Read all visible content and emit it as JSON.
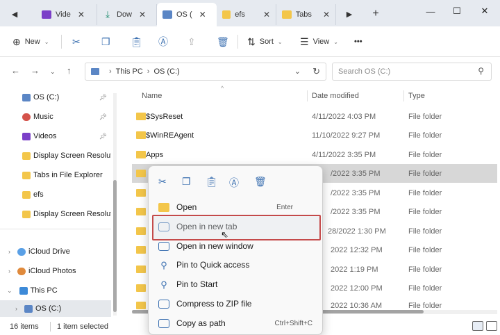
{
  "tabs": [
    {
      "label": "Vide",
      "icon": "video-icon"
    },
    {
      "label": "Dow",
      "icon": "download-icon"
    },
    {
      "label": "OS (",
      "icon": "drive-icon"
    },
    {
      "label": "efs",
      "icon": "folder-icon"
    },
    {
      "label": "Tabs",
      "icon": "folder-icon"
    }
  ],
  "toolbar": {
    "new_label": "New",
    "sort_label": "Sort",
    "view_label": "View",
    "more_label": "•••"
  },
  "address": {
    "segments": [
      "This PC",
      "OS (C:)"
    ]
  },
  "search": {
    "placeholder": "Search OS (C:)"
  },
  "sidebar": {
    "items": [
      {
        "label": "OS (C:)",
        "pinned": true
      },
      {
        "label": "Music",
        "pinned": true
      },
      {
        "label": "Videos",
        "pinned": true
      },
      {
        "label": "Display Screen Resolutio"
      },
      {
        "label": "Tabs in File Explorer"
      },
      {
        "label": "efs"
      },
      {
        "label": "Display Screen Resolutio"
      },
      {
        "label": "iCloud Drive"
      },
      {
        "label": "iCloud Photos"
      },
      {
        "label": "This PC"
      },
      {
        "label": "OS (C:)"
      }
    ]
  },
  "columns": {
    "name": "Name",
    "date": "Date modified",
    "type": "Type"
  },
  "files": [
    {
      "name": "$SysReset",
      "date": "4/11/2022 4:03 PM",
      "type": "File folder"
    },
    {
      "name": "$WinREAgent",
      "date": "11/10/2022 9:27 PM",
      "type": "File folder"
    },
    {
      "name": "Apps",
      "date": "4/11/2022 3:35 PM",
      "type": "File folder"
    },
    {
      "name": "",
      "date": "/2022 3:35 PM",
      "type": "File folder"
    },
    {
      "name": "",
      "date": "/2022 3:35 PM",
      "type": "File folder"
    },
    {
      "name": "",
      "date": "/2022 3:35 PM",
      "type": "File folder"
    },
    {
      "name": "",
      "date": "28/2022 1:30 PM",
      "type": "File folder"
    },
    {
      "name": "",
      "date": "2022 12:32 PM",
      "type": "File folder"
    },
    {
      "name": "",
      "date": "2022 1:19 PM",
      "type": "File folder"
    },
    {
      "name": "",
      "date": "2022 12:00 PM",
      "type": "File folder"
    },
    {
      "name": "",
      "date": "2022 10:36 AM",
      "type": "File folder"
    }
  ],
  "status": {
    "count": "16 items",
    "selected": "1 item selected"
  },
  "context_menu": {
    "items": [
      {
        "label": "Open",
        "shortcut": "Enter"
      },
      {
        "label": "Open in new tab",
        "shortcut": ""
      },
      {
        "label": "Open in new window",
        "shortcut": ""
      },
      {
        "label": "Pin to Quick access",
        "shortcut": ""
      },
      {
        "label": "Pin to Start",
        "shortcut": ""
      },
      {
        "label": "Compress to ZIP file",
        "shortcut": ""
      },
      {
        "label": "Copy as path",
        "shortcut": "Ctrl+Shift+C"
      }
    ]
  },
  "colors": {
    "accent": "#3a6fb0",
    "folder": "#f3c64a",
    "highlight_border": "#c44a4a"
  }
}
